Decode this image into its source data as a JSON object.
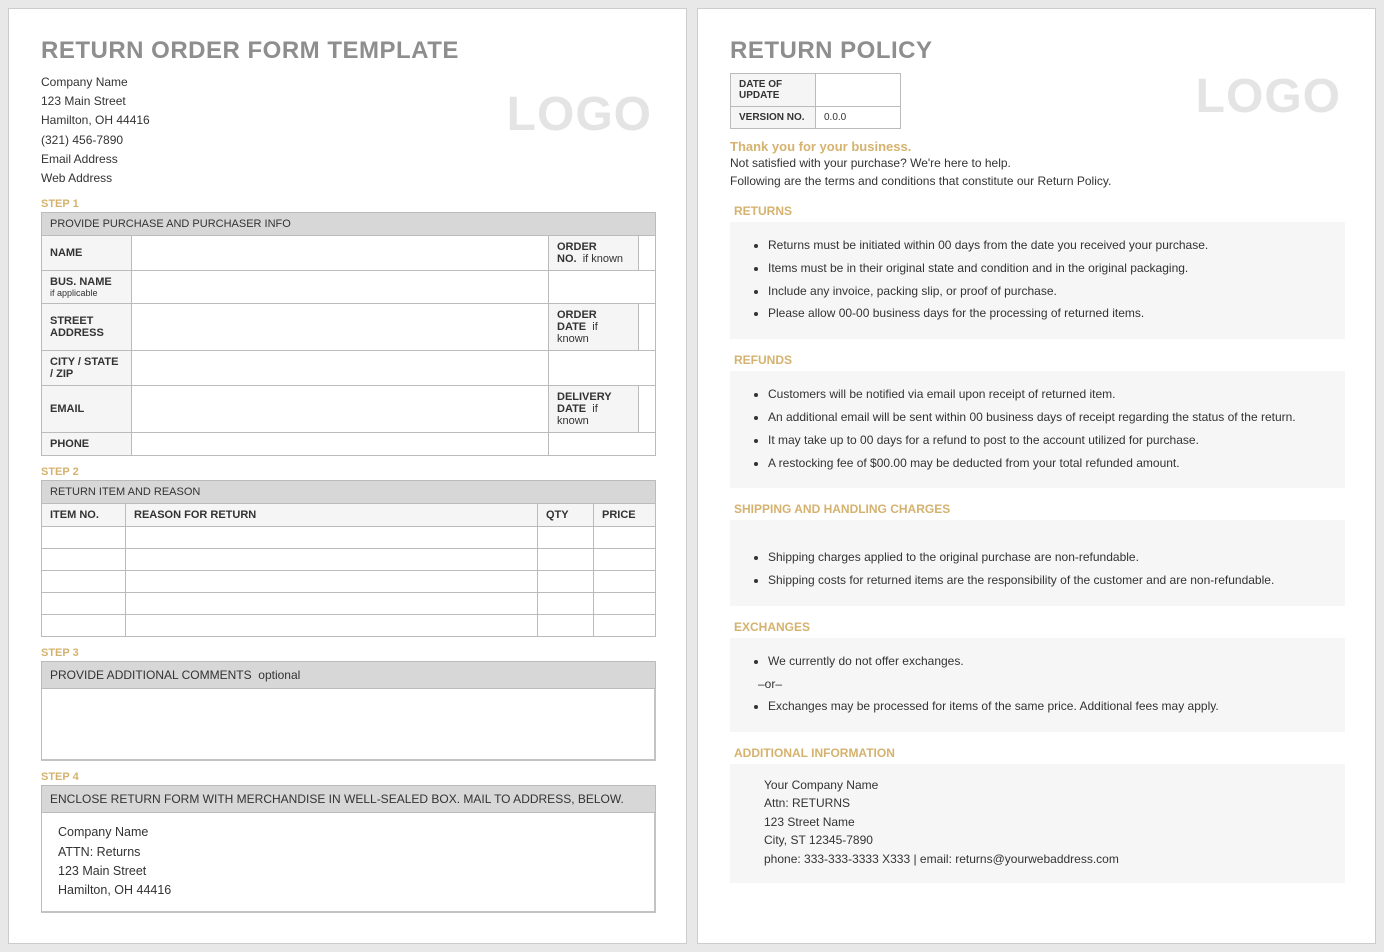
{
  "left": {
    "title": "RETURN ORDER FORM TEMPLATE",
    "company": {
      "name": "Company Name",
      "street": "123 Main Street",
      "city": "Hamilton, OH 44416",
      "phone": "(321) 456-7890",
      "email": "Email Address",
      "web": "Web Address"
    },
    "logo": "LOGO",
    "step1": {
      "label": "STEP 1",
      "header": "PROVIDE PURCHASE AND PURCHASER INFO",
      "rows": {
        "name": "NAME",
        "orderno": "ORDER NO.",
        "orderno_hint": "if known",
        "busname": "BUS. NAME",
        "busname_sub": "if applicable",
        "street": "STREET ADDRESS",
        "orderdate": "ORDER DATE",
        "orderdate_hint": "if known",
        "csz": "CITY / STATE / ZIP",
        "email": "EMAIL",
        "delivery": "DELIVERY DATE",
        "delivery_hint": "if known",
        "phone": "PHONE"
      }
    },
    "step2": {
      "label": "STEP 2",
      "header": "RETURN ITEM AND REASON",
      "cols": {
        "item": "ITEM NO.",
        "reason": "REASON FOR RETURN",
        "qty": "QTY",
        "price": "PRICE"
      }
    },
    "step3": {
      "label": "STEP 3",
      "header_a": "PROVIDE ADDITIONAL COMMENTS",
      "header_b": "optional"
    },
    "step4": {
      "label": "STEP 4",
      "header": "ENCLOSE RETURN FORM WITH MERCHANDISE IN WELL-SEALED BOX.  MAIL TO ADDRESS, BELOW.",
      "addr": {
        "name": "Company Name",
        "attn": "ATTN: Returns",
        "street": "123 Main Street",
        "city": "Hamilton, OH 44416"
      }
    }
  },
  "right": {
    "title": "RETURN POLICY",
    "logo": "LOGO",
    "meta": {
      "date_label": "DATE OF UPDATE",
      "date_val": "",
      "ver_label": "VERSION NO.",
      "ver_val": "0.0.0"
    },
    "tagline": "Thank you for your business.",
    "intro1": "Not satisfied with your purchase? We're here to help.",
    "intro2": "Following are the terms and conditions that constitute our Return Policy.",
    "returns": {
      "title": "RETURNS",
      "items": [
        "Returns must be initiated within 00 days from the date you received your purchase.",
        "Items must be in their original state and condition and in the original packaging.",
        "Include any invoice, packing slip, or proof of purchase.",
        "Please allow 00-00 business days for the processing of returned items."
      ]
    },
    "refunds": {
      "title": "REFUNDS",
      "items": [
        "Customers will be notified via email upon receipt of returned item.",
        "An additional email will be sent within 00 business days of receipt regarding the status of the return.",
        "It may take up to 00 days for a refund to post to the account utilized for purchase.",
        "A restocking fee of $00.00 may be deducted from your total refunded amount."
      ]
    },
    "shipping": {
      "title": "SHIPPING AND HANDLING CHARGES",
      "items": [
        "Shipping charges applied to the original purchase are non-refundable.",
        "Shipping costs for returned items are the responsibility of the customer and are non-refundable."
      ]
    },
    "exchanges": {
      "title": "EXCHANGES",
      "item1": "We currently do not offer exchanges.",
      "or": "–or–",
      "item2": "Exchanges may be processed for items of the same price. Additional fees may apply."
    },
    "addl": {
      "title": "ADDITIONAL INFORMATION",
      "lines": {
        "l1": "Your Company Name",
        "l2": "Attn: RETURNS",
        "l3": "123 Street Name",
        "l4": "City, ST  12345-7890",
        "l5": "phone: 333-333-3333 X333    |    email: returns@yourwebaddress.com"
      }
    }
  }
}
